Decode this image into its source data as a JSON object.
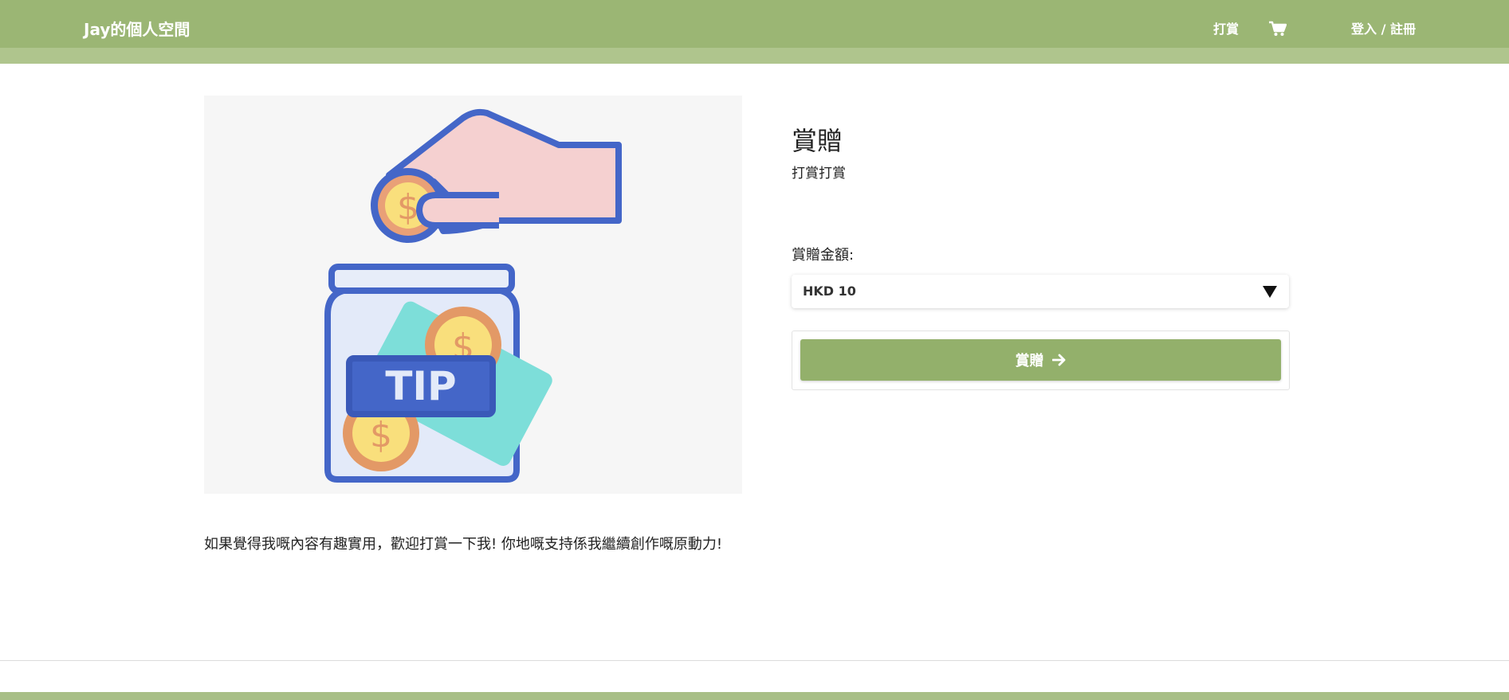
{
  "header": {
    "brand": "Jay的個人空間",
    "nav_tip": "打賞",
    "nav_cart_icon": "shopping-cart-icon",
    "nav_login": "登入 / 註冊"
  },
  "product": {
    "image_icon": "tip-jar-illustration",
    "image_text": "TIP",
    "title": "賞贈",
    "subtitle": "打賞打賞",
    "description": "如果覺得我嘅內容有趣實用，歡迎打賞一下我! 你地嘅支持係我繼續創作嘅原動力!",
    "amount_label": "賞贈金額:",
    "amount_selected": "HKD 10",
    "submit_label": "賞贈"
  },
  "colors": {
    "header_bg": "#9bb674",
    "header_strip": "#afc58d",
    "button_bg": "#93b06b",
    "footer_bar": "#a8bf87"
  }
}
